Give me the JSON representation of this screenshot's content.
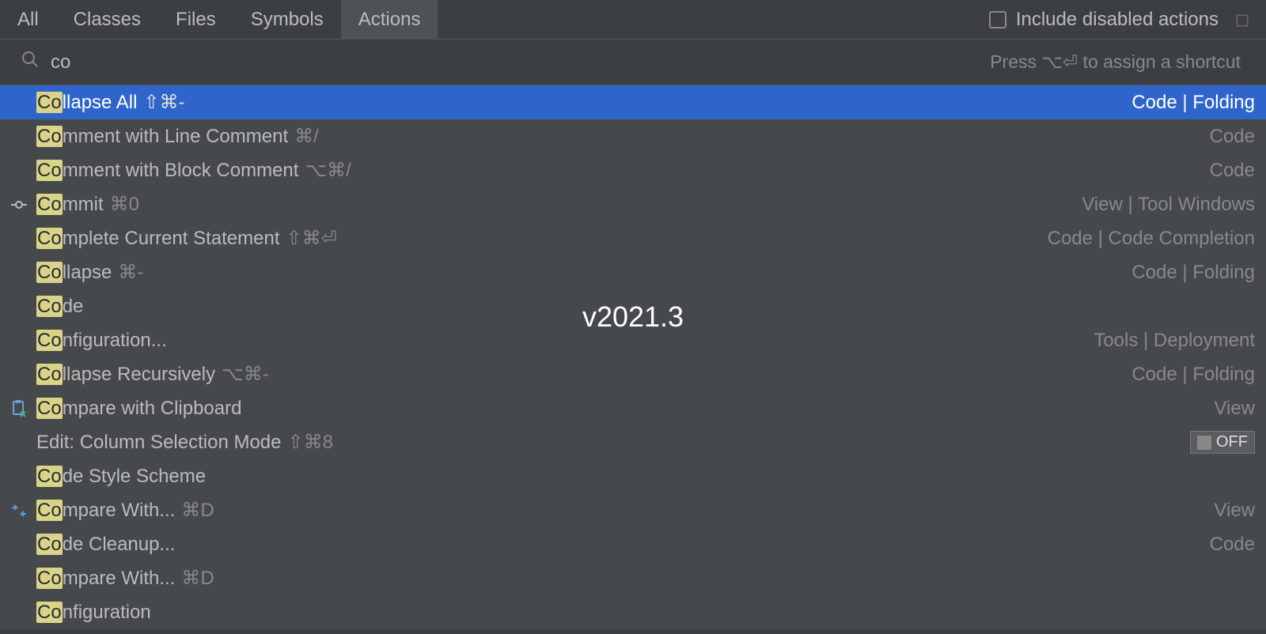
{
  "tabs": {
    "all": "All",
    "classes": "Classes",
    "files": "Files",
    "symbols": "Symbols",
    "actions": "Actions"
  },
  "include_disabled_label": "Include disabled actions",
  "search": {
    "value": "co",
    "hint": "Press ⌥⏎ to assign a shortcut"
  },
  "version": "v2021.3",
  "results": [
    {
      "prefix": "Co",
      "rest": "llapse All",
      "shortcut": "⇧⌘-",
      "location": "Code | Folding",
      "icon": "",
      "selected": true
    },
    {
      "prefix": "Co",
      "rest": "mment with Line Comment",
      "shortcut": "⌘/",
      "location": "Code",
      "icon": ""
    },
    {
      "prefix": "Co",
      "rest": "mment with Block Comment",
      "shortcut": "⌥⌘/",
      "location": "Code",
      "icon": ""
    },
    {
      "prefix": "Co",
      "rest": "mmit",
      "shortcut": "⌘0",
      "location": "View | Tool Windows",
      "icon": "commit"
    },
    {
      "prefix": "Co",
      "rest": "mplete Current Statement",
      "shortcut": "⇧⌘⏎",
      "location": "Code | Code Completion",
      "icon": ""
    },
    {
      "prefix": "Co",
      "rest": "llapse",
      "shortcut": "⌘-",
      "location": "Code | Folding",
      "icon": ""
    },
    {
      "prefix": "Co",
      "rest": "de",
      "shortcut": "",
      "location": "",
      "icon": ""
    },
    {
      "prefix": "Co",
      "rest": "nfiguration...",
      "shortcut": "",
      "location": "Tools | Deployment",
      "icon": ""
    },
    {
      "prefix": "Co",
      "rest": "llapse Recursively",
      "shortcut": "⌥⌘-",
      "location": "Code | Folding",
      "icon": ""
    },
    {
      "prefix": "Co",
      "rest": "mpare with Clipboard",
      "shortcut": "",
      "location": "View",
      "icon": "clipboard"
    },
    {
      "prefix": "",
      "rest": "Edit: Column Selection Mode",
      "shortcut": "⇧⌘8",
      "location": "",
      "icon": "",
      "toggle": "OFF"
    },
    {
      "prefix": "Co",
      "rest": "de Style Scheme",
      "shortcut": "",
      "location": "",
      "icon": ""
    },
    {
      "prefix": "Co",
      "rest": "mpare With...",
      "shortcut": "⌘D",
      "location": "View",
      "icon": "compare"
    },
    {
      "prefix": "Co",
      "rest": "de Cleanup...",
      "shortcut": "",
      "location": "Code",
      "icon": ""
    },
    {
      "prefix": "Co",
      "rest": "mpare With...",
      "shortcut": "⌘D",
      "location": "",
      "icon": ""
    },
    {
      "prefix": "Co",
      "rest": "nfiguration",
      "shortcut": "",
      "location": "",
      "icon": ""
    }
  ]
}
